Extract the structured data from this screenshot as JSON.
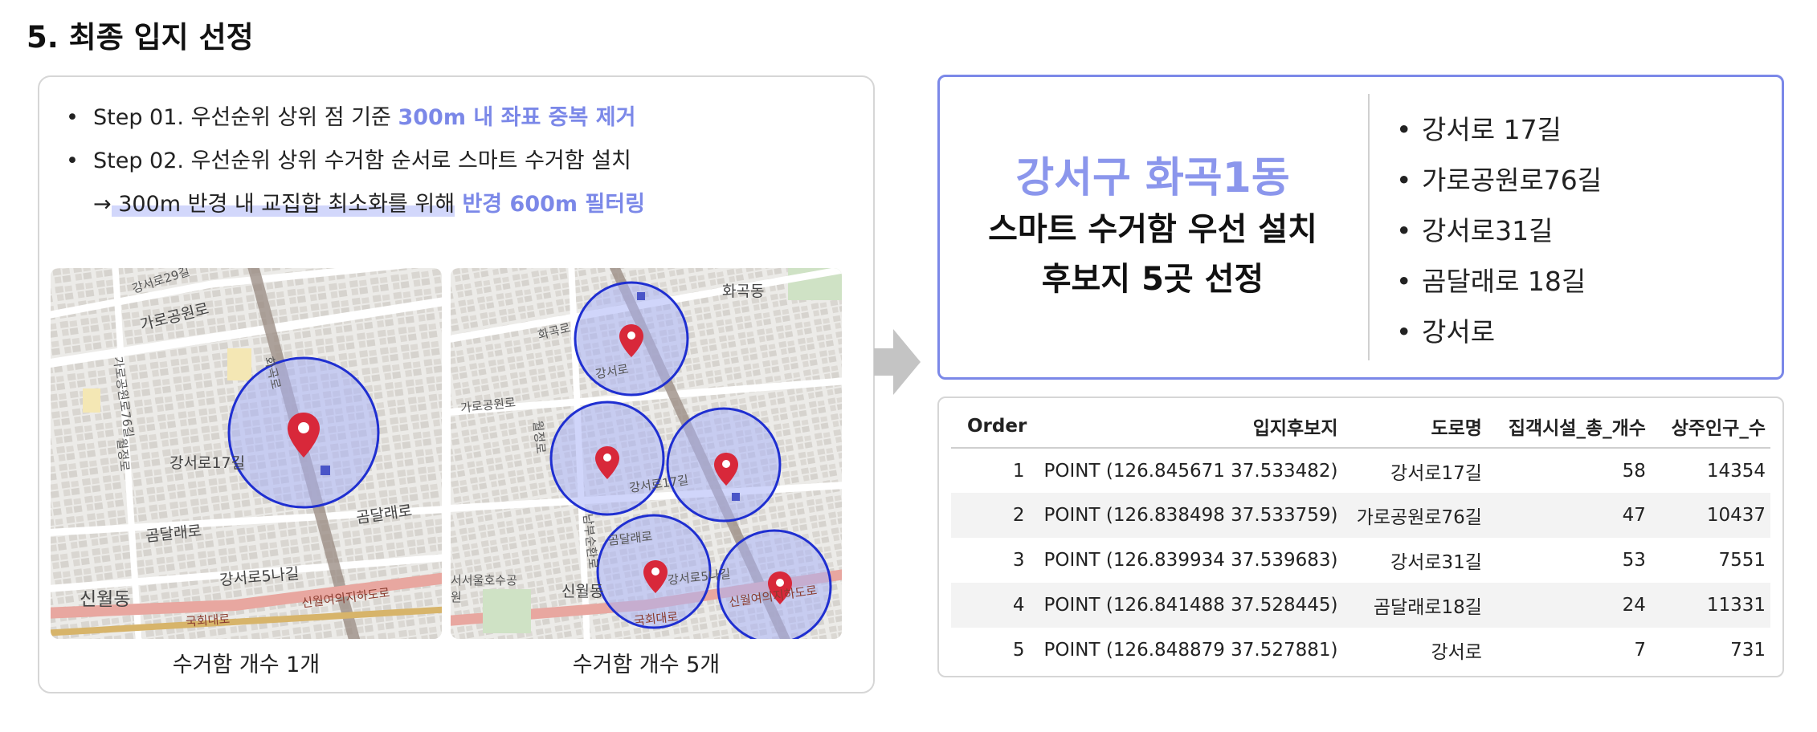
{
  "title": "5. 최종 입지 선정",
  "steps": {
    "step1_text": "Step 01. 우선순위 상위 점 기준 ",
    "step1_highlight": "300m 내 좌표 중복 제거",
    "step2_text": "Step 02. 우선순위 상위 수거함 순서로 스마트 수거함 설치",
    "step3_arrow": "→",
    "step3_marked": " 300m 반경 내 교집합 최소화를 위해",
    "step3_highlight": " 반경 600m 필터링"
  },
  "maps": {
    "map1_caption": "수거함 개수 1개",
    "map2_caption": "수거함 개수 5개",
    "map1_labels": [
      "강서로29길",
      "가로공원로",
      "가로공원로76길",
      "화곡로",
      "강서로17길",
      "곰달래로",
      "강서로5나길",
      "신월동",
      "국회대로",
      "신월여의지하도로",
      "월정로",
      "강서로"
    ],
    "map2_labels": [
      "화곡동",
      "화곡로",
      "월정로",
      "가로공원로",
      "강서로",
      "강서로17길",
      "곰달래로",
      "강서로5나길",
      "신월동",
      "국회대로",
      "신월여의지하도로",
      "서서울호수공원",
      "남부순환로"
    ]
  },
  "summary": {
    "district": "강서구 화곡1동",
    "line1": "스마트 수거함 우선 설치",
    "line2": "후보지 5곳 선정",
    "roads": [
      "강서로 17길",
      "가로공원로76길",
      "강서로31길",
      "곰달래로 18길",
      "강서로"
    ]
  },
  "table": {
    "headers": [
      "Order",
      "입지후보지",
      "도로명",
      "집객시설_총_개수",
      "상주인구_수"
    ],
    "rows": [
      [
        "1",
        "POINT (126.845671 37.533482)",
        "강서로17길",
        "58",
        "14354"
      ],
      [
        "2",
        "POINT (126.838498 37.533759)",
        "가로공원로76길",
        "47",
        "10437"
      ],
      [
        "3",
        "POINT (126.839934 37.539683)",
        "강서로31길",
        "53",
        "7551"
      ],
      [
        "4",
        "POINT (126.841488 37.528445)",
        "곰달래로18길",
        "24",
        "11331"
      ],
      [
        "5",
        "POINT (126.848879 37.527881)",
        "강서로",
        "7",
        "731"
      ]
    ]
  },
  "colors": {
    "accent": "#7b88e8",
    "circle_fill": "#aab3f5",
    "circle_stroke": "#1f2fd1",
    "pin": "#d8283a"
  },
  "icons": {
    "pin": "map-pin-icon",
    "arrow": "arrow-right-icon"
  }
}
